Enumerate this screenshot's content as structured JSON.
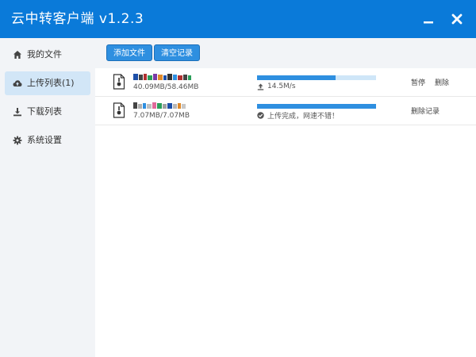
{
  "app": {
    "title": "云中转客户端 v1.2.3"
  },
  "window_controls": {
    "minimize_icon": "minimize-icon",
    "close_icon": "close-icon"
  },
  "sidebar": {
    "items": [
      {
        "label": "我的文件",
        "icon": "home-icon",
        "active": false
      },
      {
        "label": "上传列表(1)",
        "icon": "cloud-upload-icon",
        "active": true
      },
      {
        "label": "下载列表",
        "icon": "download-icon",
        "active": false
      },
      {
        "label": "系统设置",
        "icon": "gear-icon",
        "active": false
      }
    ]
  },
  "toolbar": {
    "add_label": "添加文件",
    "clear_label": "清空记录"
  },
  "uploads": [
    {
      "size": "40.09MB/58.46MB",
      "progress": 0.66,
      "status_icon": "upload-arrow-icon",
      "status": "14.5M/s",
      "actions": [
        "暂停",
        "删除"
      ]
    },
    {
      "size": "7.07MB/7.07MB",
      "progress": 1.0,
      "status_icon": "check-circle-icon",
      "status": "上传完成，网速不错！",
      "actions": [
        "删除记录"
      ]
    }
  ],
  "colors": {
    "accent": "#0a7ad9",
    "button": "#2e8fe0",
    "sidebar_bg": "#f2f4f7",
    "sidebar_active": "#d2e6f7",
    "progress_track": "#cfe6f8"
  }
}
